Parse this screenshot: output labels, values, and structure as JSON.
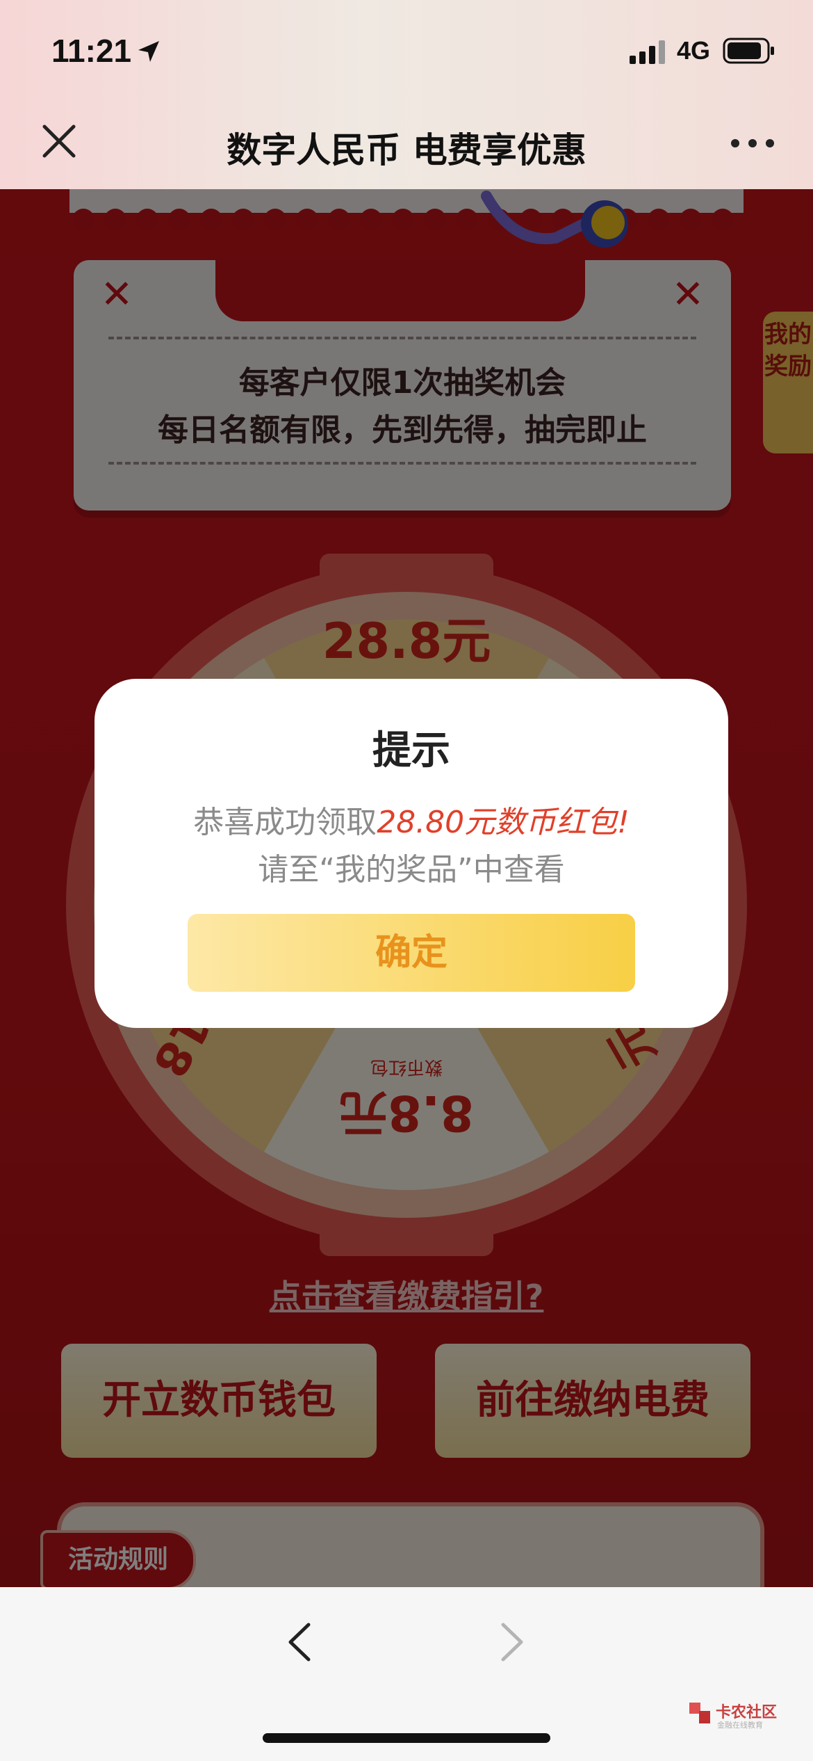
{
  "status_bar": {
    "time": "11:21",
    "network": "4G"
  },
  "header": {
    "title": "数字人民币 电费享优惠"
  },
  "notice": {
    "line1": "每客户仅限1次抽奖机会",
    "line2": "每日名额有限，先到先得，抽完即止"
  },
  "side_tab": {
    "label": "我的奖励"
  },
  "wheel": {
    "top_prize": "28.8元",
    "bottom_prize": "8.8元",
    "bottom_sub": "数币红包",
    "left_partial": "18",
    "right_partial": "元"
  },
  "guide_link": "点击查看缴费指引?",
  "buttons": {
    "open_wallet": "开立数币钱包",
    "pay_electricity": "前往缴纳电费"
  },
  "rules": {
    "tag": "活动规则"
  },
  "modal": {
    "title": "提示",
    "msg_prefix": "恭喜成功领取",
    "msg_highlight": "28.80元数币红包!",
    "msg_sub": "请至“我的奖品”中查看",
    "confirm": "确定"
  },
  "watermark": {
    "name": "卡农社区",
    "sub": "金融在线教育"
  }
}
